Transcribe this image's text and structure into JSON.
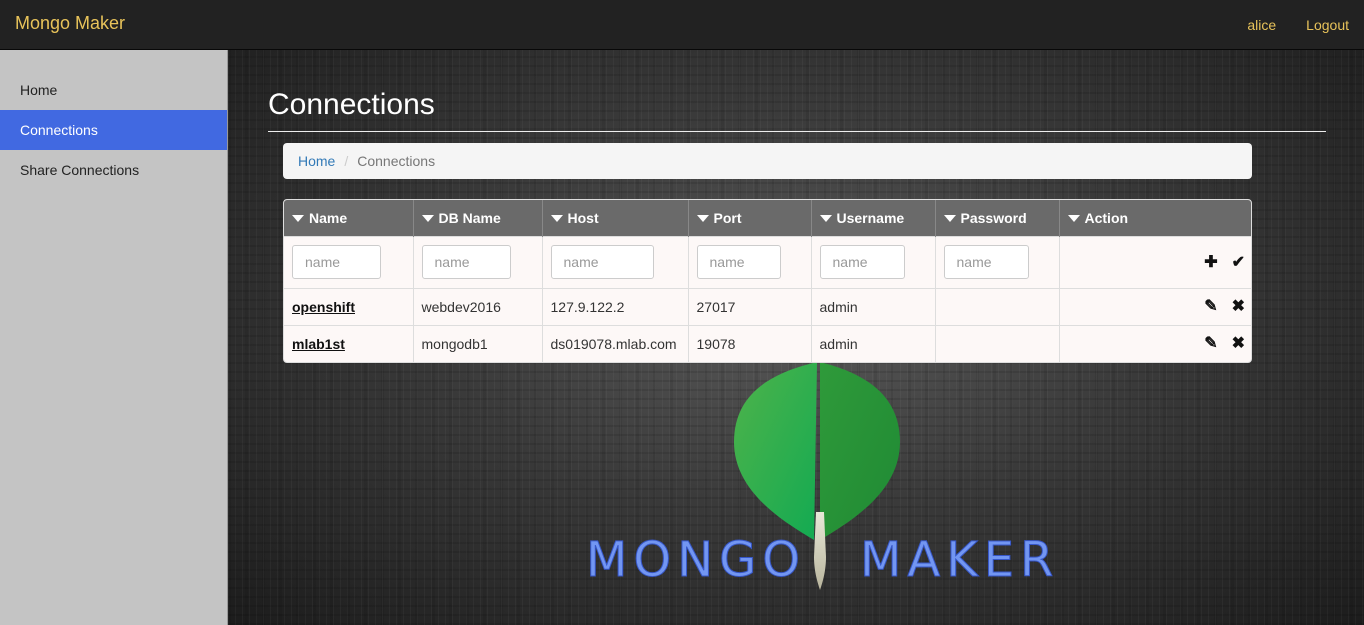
{
  "navbar": {
    "brand": "Mongo Maker",
    "user": "alice",
    "logout": "Logout"
  },
  "sidebar": {
    "items": [
      {
        "label": "Home"
      },
      {
        "label": "Connections"
      },
      {
        "label": "Share Connections"
      }
    ]
  },
  "main": {
    "title": "Connections",
    "breadcrumb": {
      "home": "Home",
      "separator": "/",
      "current": "Connections"
    }
  },
  "table": {
    "headers": [
      "Name",
      "DB Name",
      "Host",
      "Port",
      "Username",
      "Password",
      "Action"
    ],
    "filter_placeholder": "name",
    "rows": [
      {
        "name": "openshift",
        "db": "webdev2016",
        "host": "127.9.122.2",
        "port": "27017",
        "username": "admin",
        "password": ""
      },
      {
        "name": "mlab1st",
        "db": "mongodb1",
        "host": "ds019078.mlab.com",
        "port": "19078",
        "username": "admin",
        "password": ""
      }
    ]
  },
  "logo": {
    "word1": "MONGO",
    "word2": "MAKER"
  },
  "icons": {
    "add": "plus-icon",
    "confirm": "check-icon",
    "edit": "pencil-icon",
    "delete": "close-icon",
    "sort": "triangle-down-icon"
  },
  "colors": {
    "brand": "#e8c35a",
    "navbar_bg": "#222222",
    "sidebar_bg": "#c4c4c4",
    "sidebar_active": "#4169e1",
    "table_header": "#6a6a6a",
    "logo_text": "#7296f2"
  }
}
